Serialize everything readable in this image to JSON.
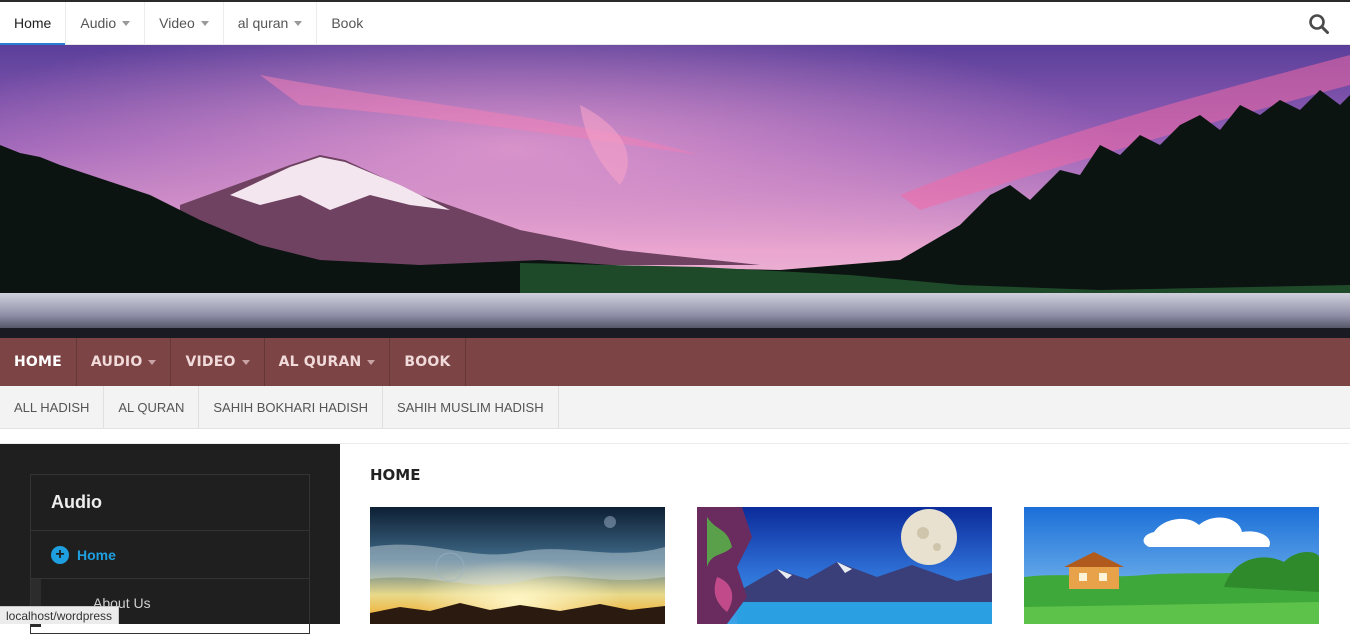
{
  "top_nav": {
    "items": [
      {
        "label": "Home",
        "dropdown": false,
        "active": true
      },
      {
        "label": "Audio",
        "dropdown": true,
        "active": false
      },
      {
        "label": "Video",
        "dropdown": true,
        "active": false
      },
      {
        "label": "al quran",
        "dropdown": true,
        "active": false
      },
      {
        "label": "Book",
        "dropdown": false,
        "active": false
      }
    ],
    "search_icon": "search-icon"
  },
  "main_nav": {
    "items": [
      {
        "label": "HOME",
        "dropdown": false
      },
      {
        "label": "AUDIO",
        "dropdown": true
      },
      {
        "label": "VIDEO",
        "dropdown": true
      },
      {
        "label": "AL QURAN",
        "dropdown": true
      },
      {
        "label": "BOOK",
        "dropdown": false
      }
    ],
    "bg_color": "#7d4445"
  },
  "sub_nav": {
    "items": [
      "ALL HADISH",
      "AL QURAN",
      "SAHIH BOKHARI HADISH",
      "SAHIH MUSLIM HADISH"
    ]
  },
  "sidebar": {
    "widget_title": "Audio",
    "items": [
      {
        "label": "Home",
        "icon": "plus-circle-icon"
      },
      {
        "label": "About Us"
      }
    ],
    "accent_color": "#1e9fe0"
  },
  "content": {
    "title": "HOME"
  },
  "status_bar": {
    "text": "localhost/wordpress"
  }
}
